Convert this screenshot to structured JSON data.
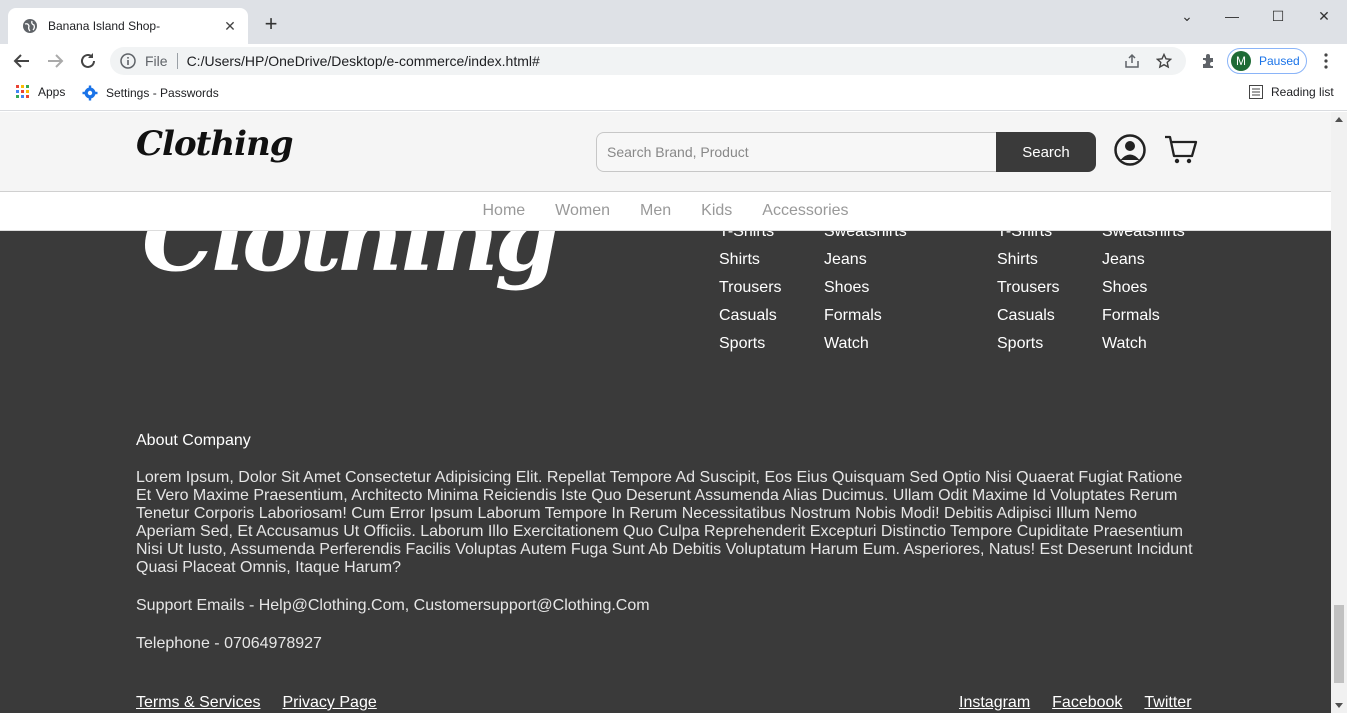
{
  "browser": {
    "tab_title": "Banana Island Shop-",
    "omnibox_prefix": "File",
    "url": "C:/Users/HP/OneDrive/Desktop/e-commerce/index.html#",
    "profile_initial": "M",
    "profile_status": "Paused",
    "bookmarks": [
      {
        "label": "Apps"
      },
      {
        "label": "Settings - Passwords"
      }
    ],
    "reading_list": "Reading list"
  },
  "header": {
    "logo_text": "Clothing",
    "search_placeholder": "Search Brand, Product",
    "search_button": "Search"
  },
  "nav": {
    "items": [
      "Home",
      "Women",
      "Men",
      "Kids",
      "Accessories"
    ]
  },
  "footer": {
    "logo_text": "Clothing",
    "columns": [
      {
        "items": [
          "T-Shirts",
          "Shirts",
          "Trousers",
          "Casuals",
          "Sports"
        ]
      },
      {
        "items": [
          "Sweatshirts",
          "Jeans",
          "Shoes",
          "Formals",
          "Watch"
        ]
      },
      {
        "items": [
          "T-Shirts",
          "Shirts",
          "Trousers",
          "Casuals",
          "Sports"
        ]
      },
      {
        "items": [
          "Sweatshirts",
          "Jeans",
          "Shoes",
          "Formals",
          "Watch"
        ]
      }
    ],
    "about_title": "About Company",
    "about_text": "Lorem Ipsum, Dolor Sit Amet Consectetur Adipisicing Elit. Repellat Tempore Ad Suscipit, Eos Eius Quisquam Sed Optio Nisi Quaerat Fugiat Ratione Et Vero Maxime Praesentium, Architecto Minima Reiciendis Iste Quo Deserunt Assumenda Alias Ducimus. Ullam Odit Maxime Id Voluptates Rerum Tenetur Corporis Laboriosam! Cum Error Ipsum Laborum Tempore In Rerum Necessitatibus Nostrum Nobis Modi! Debitis Adipisci Illum Nemo Aperiam Sed, Et Accusamus Ut Officiis. Laborum Illo Exercitationem Quo Culpa Reprehenderit Excepturi Distinctio Tempore Cupiditate Praesentium Nisi Ut Iusto, Assumenda Perferendis Facilis Voluptas Autem Fuga Sunt Ab Debitis Voluptatum Harum Eum. Asperiores, Natus! Est Deserunt Incidunt Quasi Placeat Omnis, Itaque Harum?",
    "support_emails": "Support Emails - Help@Clothing.Com, Customersupport@Clothing.Com",
    "telephone": "Telephone - 07064978927",
    "legal_links": [
      "Terms & Services",
      "Privacy Page"
    ],
    "social_links": [
      "Instagram",
      "Facebook",
      "Twitter"
    ]
  },
  "colors": {
    "footer_bg": "#3a3a3a",
    "search_button_bg": "#3a3a3a",
    "nav_text": "#999999"
  }
}
